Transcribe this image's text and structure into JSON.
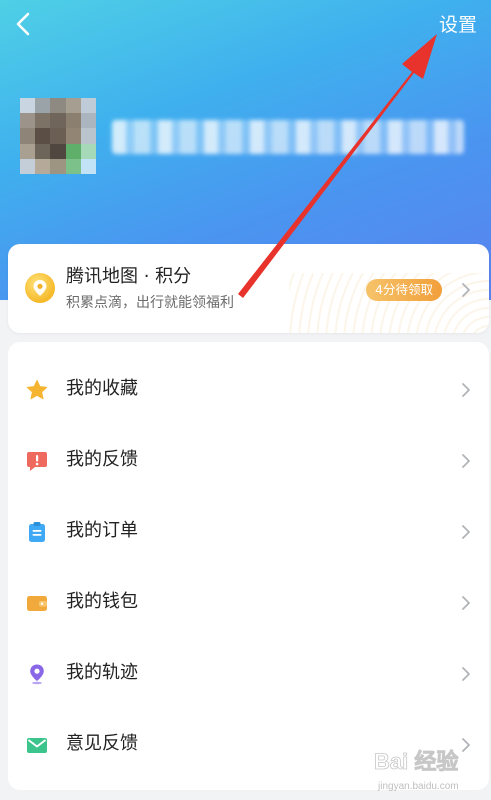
{
  "header": {
    "settings_label": "设置"
  },
  "points_card": {
    "title": "腾讯地图 · 积分",
    "subtitle": "积累点滴，出行就能领福利",
    "badge": "4分待领取"
  },
  "menu": [
    {
      "label": "我的收藏",
      "icon": "star-icon"
    },
    {
      "label": "我的反馈",
      "icon": "feedback-alert-icon"
    },
    {
      "label": "我的订单",
      "icon": "clipboard-order-icon"
    },
    {
      "label": "我的钱包",
      "icon": "wallet-icon"
    },
    {
      "label": "我的轨迹",
      "icon": "location-pin-icon"
    },
    {
      "label": "意见反馈",
      "icon": "envelope-icon"
    }
  ],
  "colors": {
    "header_gradient_start": "#4fd0e6",
    "header_gradient_end": "#5a82ee",
    "badge": "#f19f3a",
    "star": "#f5b531",
    "feedback": "#ee6a5f",
    "order": "#3fa9f5",
    "wallet": "#f2a93b",
    "track": "#8a67e6",
    "envelope": "#3cc48d",
    "annotation_arrow": "#e8322c"
  },
  "watermark": {
    "text": "Bai 经验",
    "url_text": "jingyan.baidu.com"
  }
}
